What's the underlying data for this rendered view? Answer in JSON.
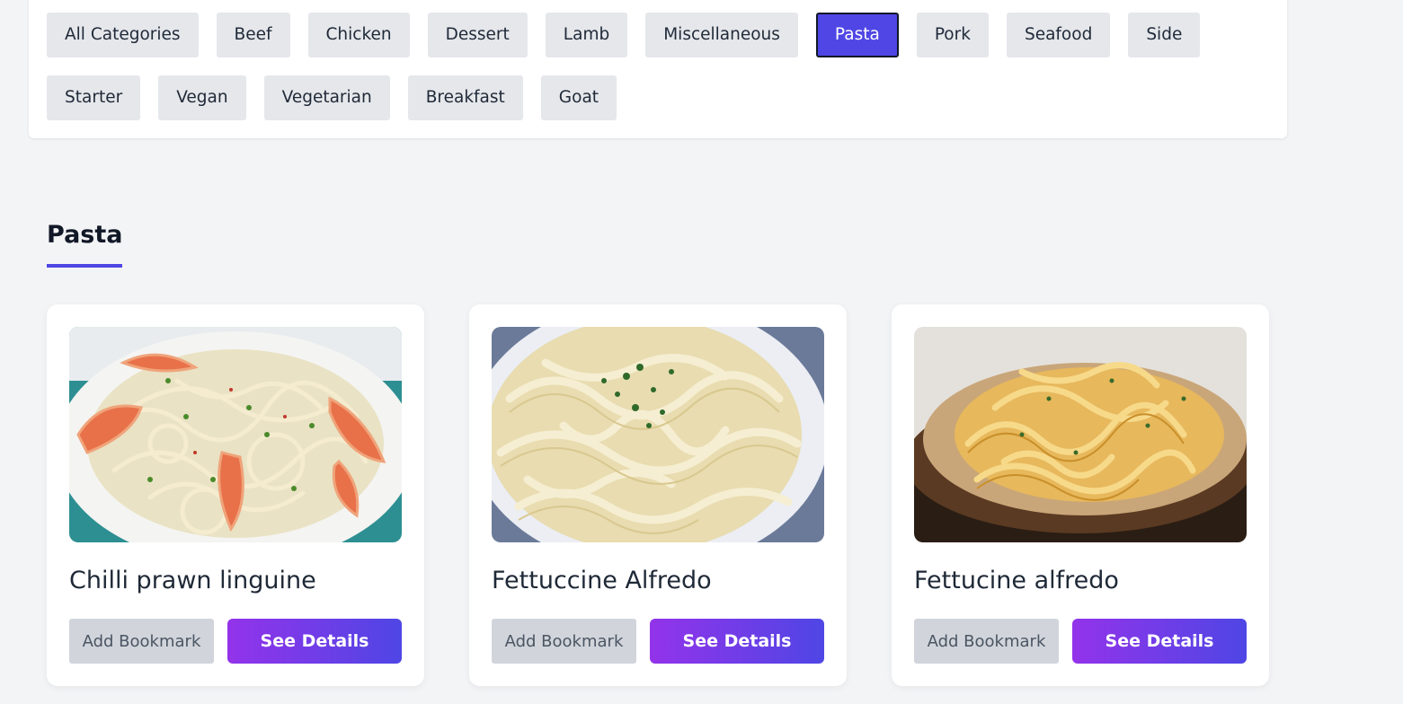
{
  "categories": {
    "row1": [
      "All Categories",
      "Beef",
      "Chicken",
      "Dessert",
      "Lamb",
      "Miscellaneous",
      "Pasta",
      "Pork",
      "Seafood",
      "Side"
    ],
    "row2": [
      "Starter",
      "Vegan",
      "Vegetarian",
      "Breakfast",
      "Goat"
    ],
    "selected": "Pasta"
  },
  "section": {
    "title": "Pasta"
  },
  "meals": [
    {
      "name": "Chilli prawn linguine",
      "image": "shrimp-linguine-photo",
      "bookmark_label": "Add Bookmark",
      "details_label": "See Details"
    },
    {
      "name": "Fettuccine Alfredo",
      "image": "fettuccine-alfredo-photo",
      "bookmark_label": "Add Bookmark",
      "details_label": "See Details"
    },
    {
      "name": "Fettucine alfredo",
      "image": "fettucine-alfredo-bowl-photo",
      "bookmark_label": "Add Bookmark",
      "details_label": "See Details"
    }
  ],
  "colors": {
    "accent": "#4f46e5",
    "page_bg": "#f3f4f6",
    "chip_bg": "#e5e7eb",
    "button_gradient_start": "#9333ea",
    "button_gradient_end": "#4f46e5"
  }
}
